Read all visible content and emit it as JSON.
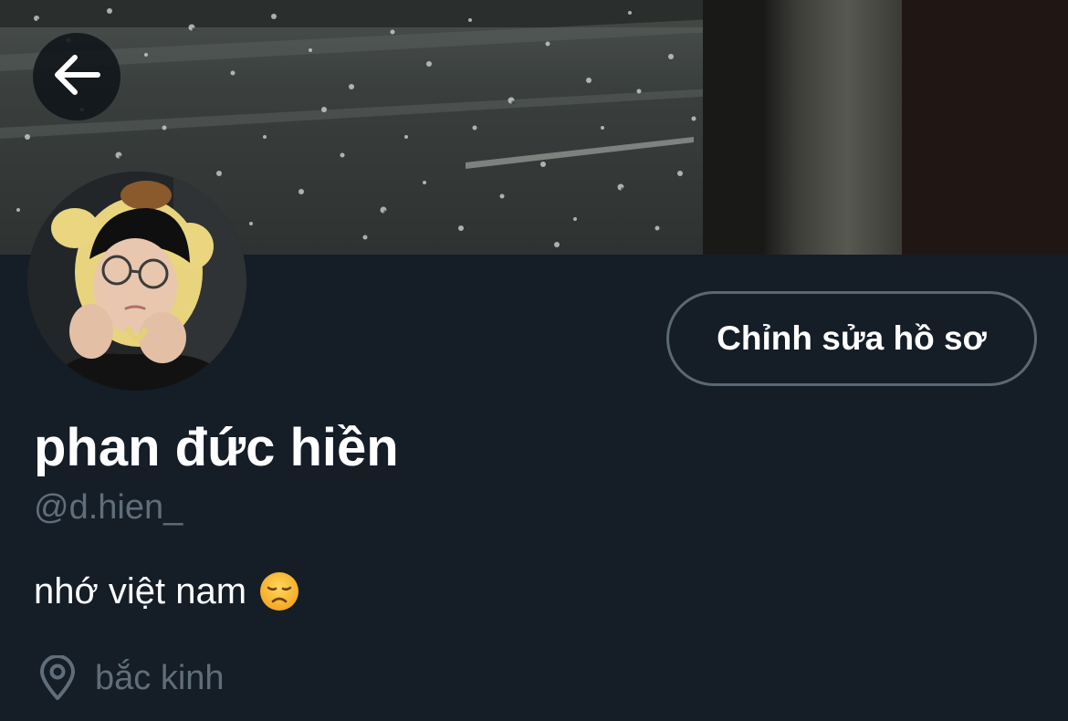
{
  "header": {
    "back_icon": "arrow-left-icon",
    "banner_description": "banner-photo"
  },
  "profile": {
    "avatar_icon": "avatar",
    "edit_button_label": "Chỉnh sửa hồ sơ",
    "display_name": "phan đức hiền",
    "handle": "@d.hien_",
    "bio_text": "nhớ việt nam",
    "bio_emoji": "disappointed-face-icon",
    "location_icon": "location-pin-icon",
    "location": "bắc kinh"
  },
  "colors": {
    "background": "#151d27",
    "secondary_text": "#5f6e7a",
    "button_border": "#5a6873",
    "primary_text": "#ffffff"
  }
}
